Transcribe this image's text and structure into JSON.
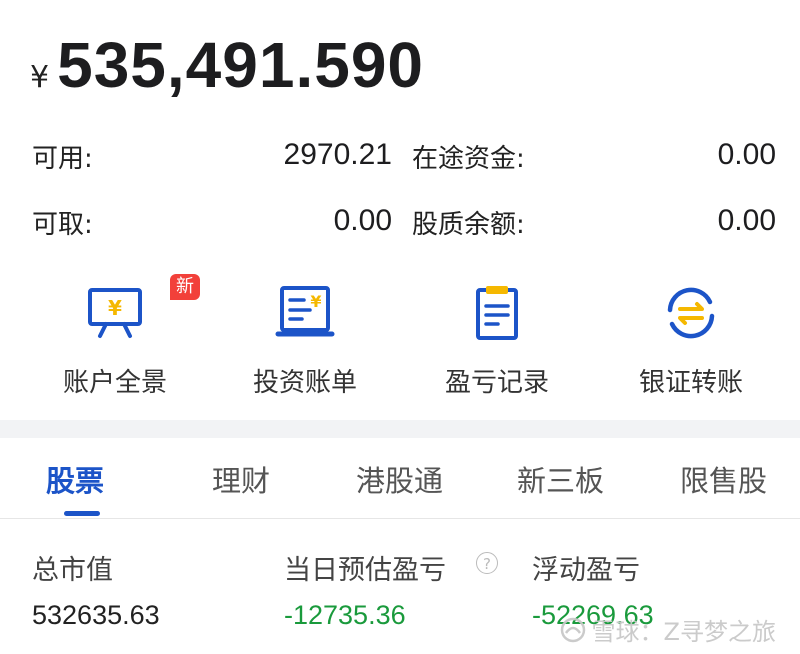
{
  "total": {
    "currency": "¥",
    "value": "535,491.590"
  },
  "balances": [
    {
      "label": "可用:",
      "value": "2970.21",
      "label2": "在途资金:",
      "value2": "0.00"
    },
    {
      "label": "可取:",
      "value": "0.00",
      "label2": "股质余额:",
      "value2": "0.00"
    }
  ],
  "actions": [
    {
      "label": "账户全景",
      "icon": "account-overview-icon",
      "badge": "新"
    },
    {
      "label": "投资账单",
      "icon": "investment-bill-icon"
    },
    {
      "label": "盈亏记录",
      "icon": "profit-loss-record-icon"
    },
    {
      "label": "银证转账",
      "icon": "bank-transfer-icon"
    }
  ],
  "tabs": [
    "股票",
    "理财",
    "港股通",
    "新三板",
    "限售股"
  ],
  "active_tab": "股票",
  "summary": {
    "market_value_label": "总市值",
    "market_value": "532635.63",
    "daily_pl_label": "当日预估盈亏",
    "daily_pl": "-12735.36",
    "float_pl_label": "浮动盈亏",
    "float_pl": "-52269.63",
    "help_icon": "?"
  },
  "watermark": "雪球：Z寻梦之旅",
  "colors": {
    "accent": "#1c54c8",
    "icon_yellow": "#f5b800",
    "badge_red": "#f2403a",
    "loss_green": "#1a9a3c"
  }
}
